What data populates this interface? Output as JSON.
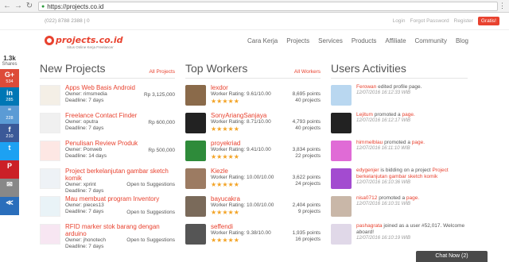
{
  "browser": {
    "url": "https://projects.co.id",
    "back": "←",
    "forward": "→",
    "reload": "↻",
    "lock": "🔒",
    "menu": "⋮"
  },
  "topbar": {
    "phone": "(022) 8788 2388 | 0",
    "login": "Login",
    "forgot": "Forgot Password",
    "register": "Register",
    "gratis": "Gratis!"
  },
  "logo": {
    "brand": "projects.co.id",
    "tagline": "Situs Online Kerja Freelancer"
  },
  "nav": [
    "Cara Kerja",
    "Projects",
    "Services",
    "Products",
    "Affiliate",
    "Community",
    "Blog"
  ],
  "social": {
    "count": "1.3k",
    "label": "Shares",
    "buttons": [
      {
        "glyph": "G+",
        "count": "534",
        "color": "#dd4b39",
        "name": "google-plus-share-button"
      },
      {
        "glyph": "in",
        "count": "285",
        "color": "#0077b5",
        "name": "linkedin-share-button"
      },
      {
        "glyph": "\"",
        "count": "228",
        "color": "#5b9bd5",
        "name": "quote-share-button"
      },
      {
        "glyph": "f",
        "count": "210",
        "color": "#3b5998",
        "name": "facebook-share-button"
      },
      {
        "glyph": "t",
        "count": "",
        "color": "#1da1f2",
        "name": "twitter-share-button"
      },
      {
        "glyph": "P",
        "count": "",
        "color": "#cb2027",
        "name": "pinterest-share-button"
      },
      {
        "glyph": "✉",
        "count": "",
        "color": "#888888",
        "name": "email-share-button"
      },
      {
        "glyph": "≪",
        "count": "",
        "color": "#2a6ebb",
        "name": "sumo-share-button"
      }
    ]
  },
  "projects": {
    "title": "New Projects",
    "link": "All Projects",
    "items": [
      {
        "title": "Apps Web Basis Android",
        "owner": "Owner: rimsmedia",
        "deadline": "Deadline: 7 days",
        "price": "Rp 3,125,000"
      },
      {
        "title": "Freelance Contact Finder",
        "owner": "Owner: oputra",
        "deadline": "Deadline: 7 days",
        "price": "Rp 600,000"
      },
      {
        "title": "Penulisan Review Produk",
        "owner": "Owner: Ponweb",
        "deadline": "Deadline: 14 days",
        "price": "Rp 500,000"
      },
      {
        "title": "Project berkelanjutan gambar sketch komik",
        "owner": "Owner: xprint",
        "deadline": "Deadline: 7 days",
        "price": "Open to Suggestions"
      },
      {
        "title": "Mau membuat program Inventory",
        "owner": "Owner: pieces13",
        "deadline": "Deadline: 7 days",
        "price": "Open to Suggestions"
      },
      {
        "title": "RFID marker stok barang dengan arduino",
        "owner": "Owner: jhonotech",
        "deadline": "Deadline: 7 days",
        "price": "Open to Suggestions"
      }
    ]
  },
  "workers": {
    "title": "Top Workers",
    "link": "All Workers",
    "items": [
      {
        "name": "lexdor",
        "rating": "Worker Rating: 9.61/10.00",
        "points": "8,695 points",
        "projects": "40 projects"
      },
      {
        "name": "SonyAriangSanjaya",
        "rating": "Worker Rating: 8.71/10.00",
        "points": "4,793 points",
        "projects": "40 projects"
      },
      {
        "name": "proyekriad",
        "rating": "Worker Rating: 9.41/10.00",
        "points": "3,834 points",
        "projects": "22 projects"
      },
      {
        "name": "Kiezle",
        "rating": "Worker Rating: 10.00/10.00",
        "points": "3,622 points",
        "projects": "24 projects"
      },
      {
        "name": "bayucakra",
        "rating": "Worker Rating: 10.00/10.00",
        "points": "2,404 points",
        "projects": "9 projects"
      },
      {
        "name": "seffendi",
        "rating": "Worker Rating: 9.38/10.00",
        "points": "1,935 points",
        "projects": "16 projects"
      }
    ]
  },
  "activities": {
    "title": "Users Activities",
    "items": [
      {
        "user": "Ferowan",
        "text": "edited profile page.",
        "text2": "",
        "time": "12/07/2016 16:12:33 WIB"
      },
      {
        "user": "Lejitum",
        "text": "promoted a",
        "text2": "page.",
        "time": "12/07/2016 16:12:17 WIB"
      },
      {
        "user": "himmelblau",
        "text": "promoted a",
        "text2": "page.",
        "time": "12/07/2016 16:11:10 WIB"
      },
      {
        "user": "edygenjer",
        "text": "is bidding on a project",
        "text2": "Project berkelanjutan gambar sketch komik",
        "time": "12/07/2016 16:10:36 WIB"
      },
      {
        "user": "nisa0712",
        "text": "promoted a",
        "text2": "page.",
        "time": "12/07/2016 16:10:31 WIB"
      },
      {
        "user": "pashagrata",
        "text": "joined as a user #52,017. Welcome aboard!",
        "text2": "",
        "time": "12/07/2016 16:10:19 WIB"
      }
    ]
  },
  "chat": {
    "label": "Chat Now (2)"
  }
}
